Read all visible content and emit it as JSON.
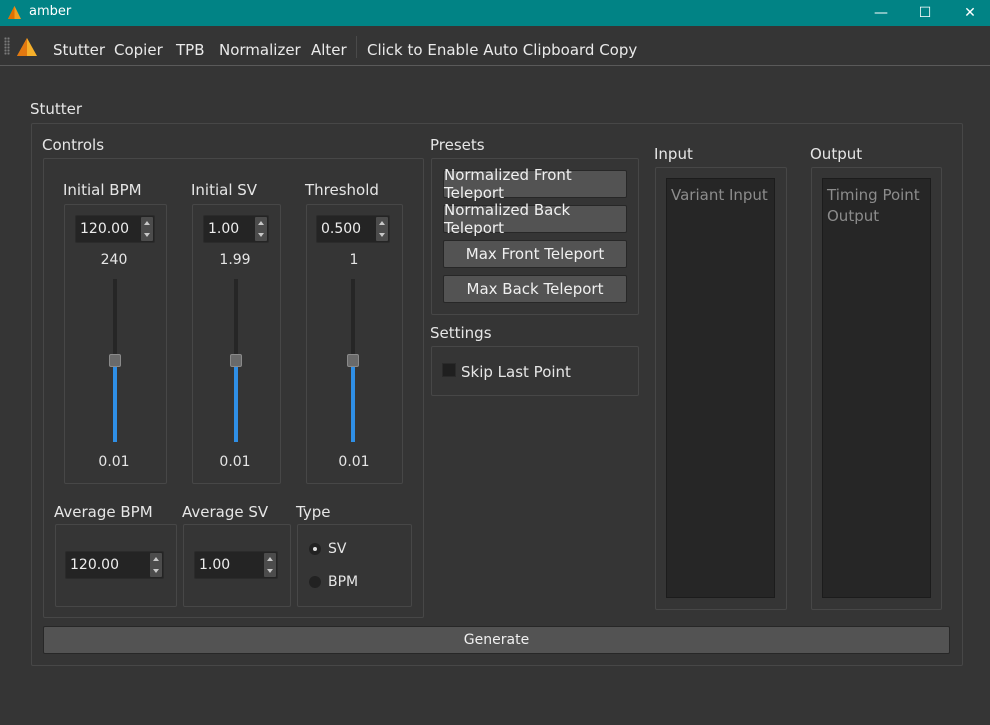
{
  "window": {
    "title": "amber",
    "minimize": "—",
    "maximize": "☐",
    "close": "✕"
  },
  "menubar": {
    "items": [
      "Stutter",
      "Copier",
      "TPB",
      "Normalizer",
      "Alter"
    ],
    "clipboard_action": "Click to Enable Auto Clipboard Copy"
  },
  "stutter": {
    "title": "Stutter",
    "controls": {
      "title": "Controls",
      "initial_bpm": {
        "label": "Initial BPM",
        "value": "120.00",
        "max": "240",
        "min": "0.01",
        "level": 0.5
      },
      "initial_sv": {
        "label": "Initial SV",
        "value": "1.00",
        "max": "1.99",
        "min": "0.01",
        "level": 0.5
      },
      "threshold": {
        "label": "Threshold",
        "value": "0.500",
        "max": "1",
        "min": "0.01",
        "level": 0.5
      },
      "average_bpm": {
        "label": "Average BPM",
        "value": "120.00"
      },
      "average_sv": {
        "label": "Average SV",
        "value": "1.00"
      },
      "type": {
        "label": "Type",
        "options": [
          "SV",
          "BPM"
        ],
        "selected": "SV"
      }
    },
    "presets": {
      "title": "Presets",
      "buttons": [
        "Normalized Front Teleport",
        "Normalized Back Teleport",
        "Max Front Teleport",
        "Max Back Teleport"
      ]
    },
    "settings": {
      "title": "Settings",
      "skip_last_point": "Skip Last Point",
      "skip_last_point_checked": false
    },
    "input": {
      "title": "Input",
      "placeholder": "Variant Input"
    },
    "output": {
      "title": "Output",
      "placeholder": "Timing Point\nOutput"
    },
    "generate": "Generate"
  },
  "colors": {
    "titlebar": "#018385",
    "slider_fill": "#2f8fe6",
    "background": "#353535"
  },
  "icons": {
    "app": "amber-triangle-icon"
  }
}
